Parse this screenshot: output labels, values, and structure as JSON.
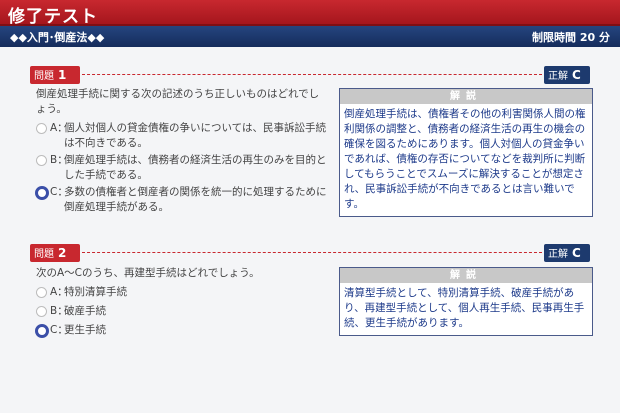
{
  "header": {
    "title": "修了テスト",
    "subtitle": "◆◆入門･倒産法◆◆",
    "time_limit": "制限時間 20 分"
  },
  "colors": {
    "red": "#c8282f",
    "navy": "#1d3a6e",
    "answer_text": "#1d3a8a",
    "selected_radio": "#3b4fa8"
  },
  "questions": [
    {
      "label": "問題",
      "number": "1",
      "answer_label": "正解",
      "answer": "C",
      "text": "倒産処理手続に関する次の記述のうち正しいものはどれでしょう。",
      "choices": [
        {
          "letter": "A：",
          "text": "個人対個人の貸金債権の争いについては、民事訴訟手続は不向きである。",
          "selected": false
        },
        {
          "letter": "B：",
          "text": "倒産処理手続は、債務者の経済生活の再生のみを目的とした手続である。",
          "selected": false
        },
        {
          "letter": "C：",
          "text": "多数の債権者と倒産者の関係を統一的に処理するために倒産処理手続がある。",
          "selected": true
        }
      ],
      "explanation_title": "解説",
      "explanation": "倒産処理手続は、債権者その他の利害関係人間の権利関係の調整と、債務者の経済生活の再生の機会の確保を図るためにあります。個人対個人の貸金争いであれば、債権の存否についてなどを裁判所に判断してもらうことでスムーズに解決することが想定され、民事訴訟手続が不向きであるとは言い難いです。"
    },
    {
      "label": "問題",
      "number": "2",
      "answer_label": "正解",
      "answer": "C",
      "text": "次のA～Cのうち、再建型手続はどれでしょう。",
      "choices": [
        {
          "letter": "A：",
          "text": "特別清算手続",
          "selected": false
        },
        {
          "letter": "B：",
          "text": "破産手続",
          "selected": false
        },
        {
          "letter": "C：",
          "text": "更生手続",
          "selected": true
        }
      ],
      "explanation_title": "解説",
      "explanation": "清算型手続として、特別清算手続、破産手続があり、再建型手続として、個人再生手続、民事再生手続、更生手続があります。"
    }
  ]
}
